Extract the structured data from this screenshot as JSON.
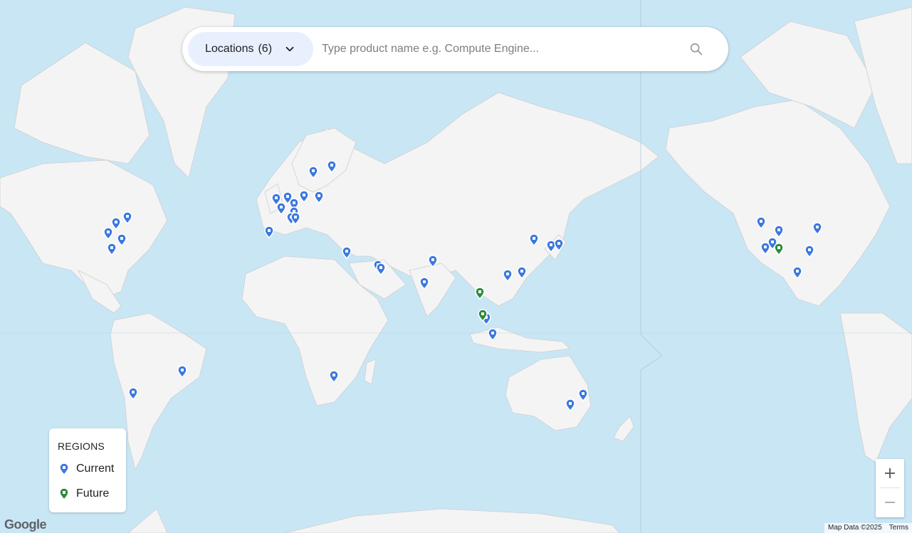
{
  "search": {
    "locations_label": "Locations",
    "locations_count": "(6)",
    "placeholder": "Type product name e.g. Compute Engine..."
  },
  "legend": {
    "title": "REGIONS",
    "current_label": "Current",
    "future_label": "Future"
  },
  "zoom": {
    "in_label": "+",
    "out_label": "—"
  },
  "branding": {
    "logo": "Google"
  },
  "attribution": {
    "map_data": "Map Data ©2025",
    "terms": "Terms"
  },
  "colors": {
    "current": "#3b78e0",
    "future": "#2e8b3c",
    "water": "#c9e6f5",
    "land": "#f4f4f4"
  }
}
